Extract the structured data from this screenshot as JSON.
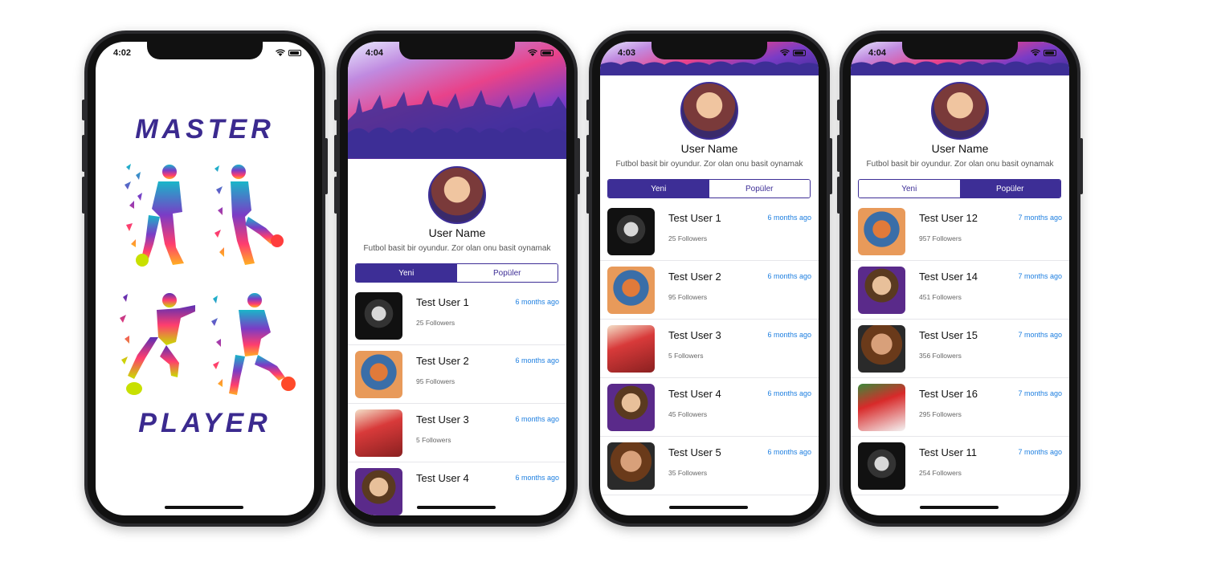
{
  "splash": {
    "status_time": "4:02",
    "title_top": "MASTER",
    "title_bottom": "PLAYER"
  },
  "profile": {
    "user_name": "User Name",
    "bio": "Futbol basit bir oyundur. Zor olan onu basit oynamak",
    "tab_new": "Yeni",
    "tab_popular": "Popüler"
  },
  "screens": [
    {
      "status_time": "4:04",
      "active_tab": "new",
      "users": [
        {
          "name": "Test User 1",
          "followers": "25 Followers",
          "time": "6 months ago",
          "thumb": "mono"
        },
        {
          "name": "Test User 2",
          "followers": "95 Followers",
          "time": "6 months ago",
          "thumb": "orange"
        },
        {
          "name": "Test User 3",
          "followers": "5 Followers",
          "time": "6 months ago",
          "thumb": "red"
        },
        {
          "name": "Test User 4",
          "followers": "",
          "time": "6 months ago",
          "thumb": "purple"
        }
      ]
    },
    {
      "status_time": "4:03",
      "active_tab": "new",
      "users": [
        {
          "name": "Test User 1",
          "followers": "25 Followers",
          "time": "6 months ago",
          "thumb": "mono"
        },
        {
          "name": "Test User 2",
          "followers": "95 Followers",
          "time": "6 months ago",
          "thumb": "orange"
        },
        {
          "name": "Test User 3",
          "followers": "5 Followers",
          "time": "6 months ago",
          "thumb": "red"
        },
        {
          "name": "Test User 4",
          "followers": "45 Followers",
          "time": "6 months ago",
          "thumb": "purple"
        },
        {
          "name": "Test User 5",
          "followers": "35 Followers",
          "time": "6 months ago",
          "thumb": "brown"
        }
      ]
    },
    {
      "status_time": "4:04",
      "active_tab": "popular",
      "users": [
        {
          "name": "Test User 12",
          "followers": "957 Followers",
          "time": "7 months ago",
          "thumb": "orange"
        },
        {
          "name": "Test User 14",
          "followers": "451 Followers",
          "time": "7 months ago",
          "thumb": "purple"
        },
        {
          "name": "Test User 15",
          "followers": "356 Followers",
          "time": "7 months ago",
          "thumb": "brown"
        },
        {
          "name": "Test User 16",
          "followers": "295 Followers",
          "time": "7 months ago",
          "thumb": "red"
        },
        {
          "name": "Test User 11",
          "followers": "254 Followers",
          "time": "7 months ago",
          "thumb": "mono"
        }
      ]
    }
  ],
  "colors": {
    "accent": "#3d2e96",
    "link": "#1e7fe0"
  }
}
